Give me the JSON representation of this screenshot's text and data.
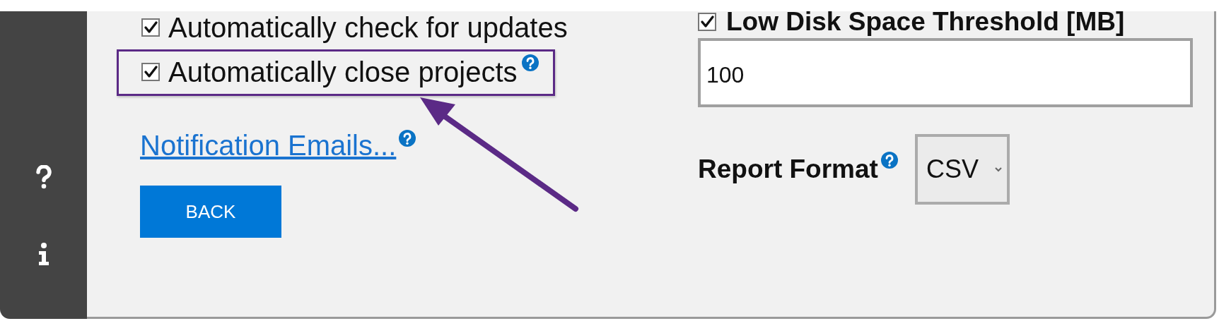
{
  "sidebar": {
    "items": [
      {
        "kind": "help"
      },
      {
        "kind": "info"
      }
    ]
  },
  "general": {
    "checkboxes": [
      {
        "label": "Automatically check for updates",
        "checked": true,
        "highlighted": false,
        "help": false
      },
      {
        "label": "Automatically close projects",
        "checked": true,
        "highlighted": true,
        "help": true
      }
    ],
    "link": {
      "label": "Notification Emails...",
      "help": true
    },
    "buttons": [
      "BACK"
    ]
  },
  "disk_space": {
    "label": "Low Disk Space Threshold [MB]",
    "checked": true,
    "value": "100"
  },
  "report_format": {
    "label": "Report Format",
    "value": "CSV",
    "help": true
  }
}
